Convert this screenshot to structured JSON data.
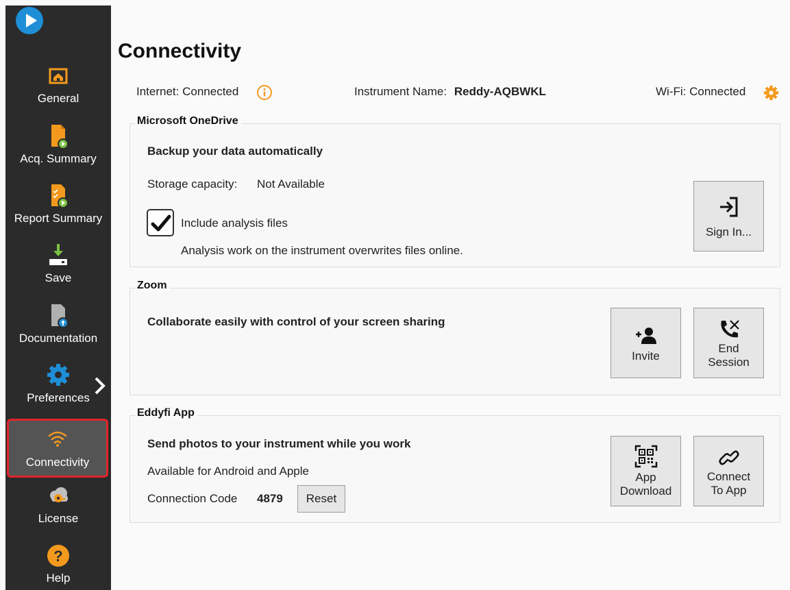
{
  "sidebar": {
    "items": [
      {
        "label": "General",
        "icon": "home-icon"
      },
      {
        "label": "Acq. Summary",
        "icon": "acq-summary-icon"
      },
      {
        "label": "Report Summary",
        "icon": "report-summary-icon"
      },
      {
        "label": "Save",
        "icon": "save-icon"
      },
      {
        "label": "Documentation",
        "icon": "documentation-icon"
      },
      {
        "label": "Preferences",
        "icon": "gear-icon"
      },
      {
        "label": "Connectivity",
        "icon": "wifi-icon"
      },
      {
        "label": "License",
        "icon": "license-icon"
      },
      {
        "label": "Help",
        "icon": "help-icon"
      }
    ],
    "active": "Connectivity"
  },
  "page": {
    "title": "Connectivity",
    "internet_label": "Internet:",
    "internet_value": "Connected",
    "instrument_label": "Instrument Name:",
    "instrument_value": "Reddy-AQBWKL",
    "wifi_label": "Wi-Fi:",
    "wifi_value": "Connected"
  },
  "onedrive": {
    "legend": "Microsoft OneDrive",
    "heading": "Backup your data automatically",
    "storage_label": "Storage capacity:",
    "storage_value": "Not Available",
    "include_label": "Include analysis files",
    "include_checked": true,
    "note": "Analysis work on the instrument overwrites files online.",
    "sign_in_label": "Sign In..."
  },
  "zoom": {
    "legend": "Zoom",
    "heading": "Collaborate easily with control of your screen sharing",
    "invite_label": "Invite",
    "end_line1": "End",
    "end_line2": "Session"
  },
  "eddyfi": {
    "legend": "Eddyfi App",
    "heading": "Send photos to your instrument while you work",
    "availability": "Available for Android and Apple",
    "code_label": "Connection Code",
    "code_value": "4879",
    "reset_label": "Reset",
    "download_line1": "App",
    "download_line2": "Download",
    "connect_line1": "Connect",
    "connect_line2": "To App"
  },
  "colors": {
    "accent_orange": "#f39a1e",
    "accent_blue": "#1e8fd6",
    "sidebar_bg": "#2b2b2b",
    "active_border": "#e4232b"
  }
}
